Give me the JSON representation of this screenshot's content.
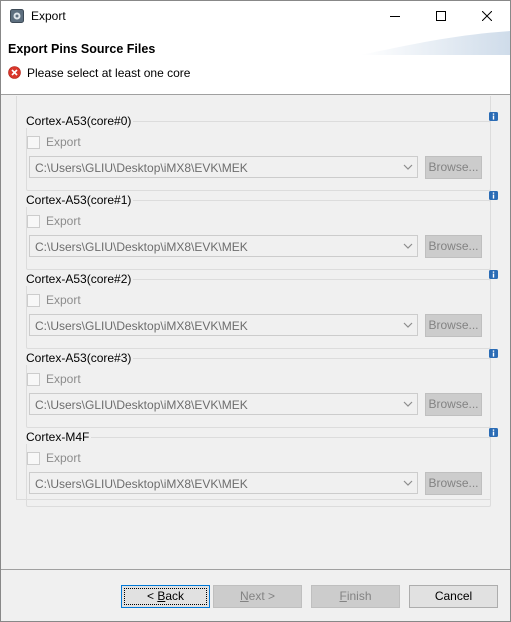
{
  "window": {
    "title": "Export"
  },
  "banner": {
    "title": "Export Pins Source Files",
    "message": "Please select at least one core"
  },
  "groups": [
    {
      "label": "Cortex-A53(core#0)",
      "checkbox_label": "Export",
      "path": "C:\\Users\\GLIU\\Desktop\\iMX8\\EVK\\MEK",
      "browse_label": "Browse..."
    },
    {
      "label": "Cortex-A53(core#1)",
      "checkbox_label": "Export",
      "path": "C:\\Users\\GLIU\\Desktop\\iMX8\\EVK\\MEK",
      "browse_label": "Browse..."
    },
    {
      "label": "Cortex-A53(core#2)",
      "checkbox_label": "Export",
      "path": "C:\\Users\\GLIU\\Desktop\\iMX8\\EVK\\MEK",
      "browse_label": "Browse..."
    },
    {
      "label": "Cortex-A53(core#3)",
      "checkbox_label": "Export",
      "path": "C:\\Users\\GLIU\\Desktop\\iMX8\\EVK\\MEK",
      "browse_label": "Browse..."
    },
    {
      "label": "Cortex-M4F",
      "checkbox_label": "Export",
      "path": "C:\\Users\\GLIU\\Desktop\\iMX8\\EVK\\MEK",
      "browse_label": "Browse..."
    }
  ],
  "footer": {
    "back_prefix": "< ",
    "back_mnemonic": "B",
    "back_rest": "ack",
    "next_mnemonic": "N",
    "next_rest": "ext >",
    "finish_mnemonic": "F",
    "finish_rest": "inish",
    "cancel": "Cancel"
  },
  "icons": {
    "app": "export-app-icon",
    "error": "error-icon",
    "info": "info-icon",
    "dropdown": "chevron-down-icon"
  },
  "colors": {
    "error": "#d9362b",
    "info": "#2b6cb5",
    "focus_border": "#0078d7"
  }
}
